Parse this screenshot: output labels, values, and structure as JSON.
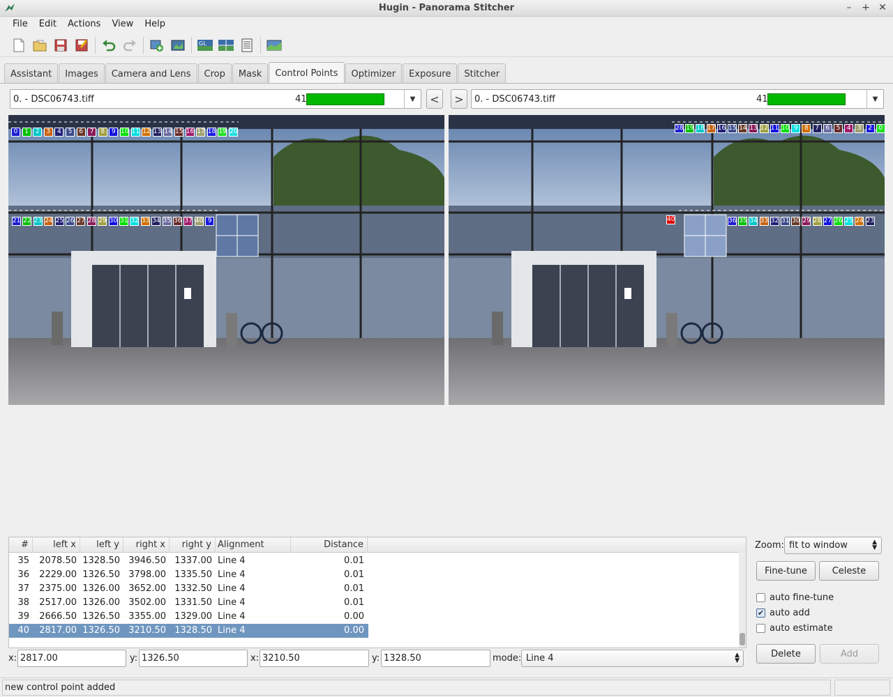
{
  "window": {
    "title": "Hugin - Panorama Stitcher",
    "minimize": "–",
    "maximize": "+",
    "close": "✕"
  },
  "menu": [
    "File",
    "Edit",
    "Actions",
    "View",
    "Help"
  ],
  "toolbar": {
    "icons": [
      "new-project-icon",
      "open-project-icon",
      "save-icon",
      "save-as-icon",
      "undo-icon",
      "redo-icon",
      "add-images-icon",
      "assistant-icon",
      "gl-preview-icon",
      "panorama-preview-icon",
      "pto-edit-icon",
      "stitch-icon"
    ]
  },
  "tabs": [
    "Assistant",
    "Images",
    "Camera and Lens",
    "Crop",
    "Mask",
    "Control Points",
    "Optimizer",
    "Exposure",
    "Stitcher"
  ],
  "active_tab": "Control Points",
  "left_image": {
    "name": "0. - DSC06743.tiff",
    "count": "41",
    "quality": 1.0
  },
  "right_image": {
    "name": "0. - DSC06743.tiff",
    "count": "41",
    "quality": 1.0
  },
  "nav": {
    "prev": "<",
    "next": ">"
  },
  "left_points_top": [
    "0",
    "1",
    "2",
    "3",
    "4",
    "5",
    "6",
    "7",
    "8",
    "9",
    "10",
    "11",
    "12",
    "13",
    "14",
    "15",
    "16",
    "17",
    "18",
    "19",
    "20"
  ],
  "left_points_bottom": [
    "21",
    "22",
    "23",
    "24",
    "25",
    "26",
    "27",
    "28",
    "29",
    "30",
    "31",
    "32",
    "33",
    "34",
    "35",
    "36",
    "37",
    "40",
    "9"
  ],
  "right_points_top": [
    "28",
    "19",
    "18",
    "17",
    "16",
    "15",
    "14",
    "13",
    "12",
    "11",
    "10",
    "9",
    "8",
    "7",
    "6",
    "5",
    "4",
    "3",
    "2",
    "0"
  ],
  "right_points_bottom": [
    "36",
    "35",
    "34",
    "33",
    "32",
    "31",
    "30",
    "29",
    "28",
    "27",
    "26",
    "25",
    "24",
    "23"
  ],
  "right_point_selected": "40",
  "table": {
    "columns": [
      "#",
      "left x",
      "left y",
      "right x",
      "right y",
      "Alignment",
      "Distance"
    ],
    "rows": [
      [
        "35",
        "2078.50",
        "1328.50",
        "3946.50",
        "1337.00",
        "Line 4",
        "0.01"
      ],
      [
        "36",
        "2229.00",
        "1326.50",
        "3798.00",
        "1335.50",
        "Line 4",
        "0.01"
      ],
      [
        "37",
        "2375.00",
        "1326.00",
        "3652.00",
        "1332.50",
        "Line 4",
        "0.01"
      ],
      [
        "38",
        "2517.00",
        "1326.00",
        "3502.00",
        "1331.50",
        "Line 4",
        "0.01"
      ],
      [
        "39",
        "2666.50",
        "1326.50",
        "3355.00",
        "1329.00",
        "Line 4",
        "0.00"
      ],
      [
        "40",
        "2817.00",
        "1326.50",
        "3210.50",
        "1328.50",
        "Line 4",
        "0.00"
      ]
    ],
    "selected_row": 5
  },
  "zoom": {
    "label": "Zoom:",
    "value": "fit to window"
  },
  "buttons": {
    "fine_tune": "Fine-tune",
    "celeste": "Celeste",
    "delete": "Delete",
    "add": "Add"
  },
  "checkboxes": [
    {
      "label": "auto fine-tune",
      "checked": false
    },
    {
      "label": "auto add",
      "checked": true
    },
    {
      "label": "auto estimate",
      "checked": false
    }
  ],
  "coords": {
    "left_x_label": "x:",
    "left_x": "2817.00",
    "left_y_label": "y:",
    "left_y": "1326.50",
    "right_x_label": "x:",
    "right_x": "3210.50",
    "right_y_label": "y:",
    "right_y": "1328.50",
    "mode_label": "mode:",
    "mode": "Line 4"
  },
  "status": "new control point added",
  "colors": {
    "progress": "#00b800",
    "selected_row": "#6f96bf"
  }
}
